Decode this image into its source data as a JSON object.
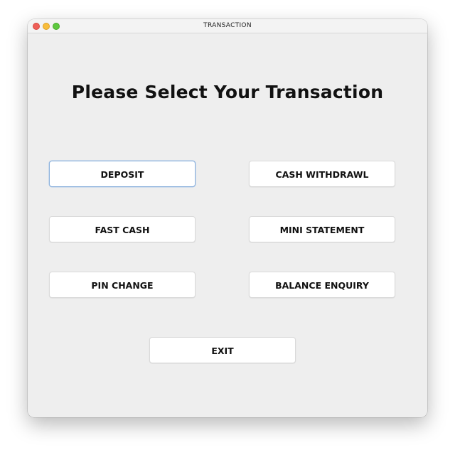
{
  "window": {
    "title": "TRANSACTION"
  },
  "main": {
    "heading": "Please Select Your Transaction",
    "buttons": {
      "deposit": "DEPOSIT",
      "cash_withdrawl": "CASH WITHDRAWL",
      "fast_cash": "FAST CASH",
      "mini_statement": "MINI STATEMENT",
      "pin_change": "PIN CHANGE",
      "balance_enquiry": "BALANCE ENQUIRY",
      "exit": "EXIT"
    }
  },
  "colors": {
    "window_bg": "#eeeeee",
    "close": "#ee5f58",
    "minimize": "#f8bd3b",
    "maximize": "#5ec83f",
    "focus_ring": "#8fb3dd"
  }
}
